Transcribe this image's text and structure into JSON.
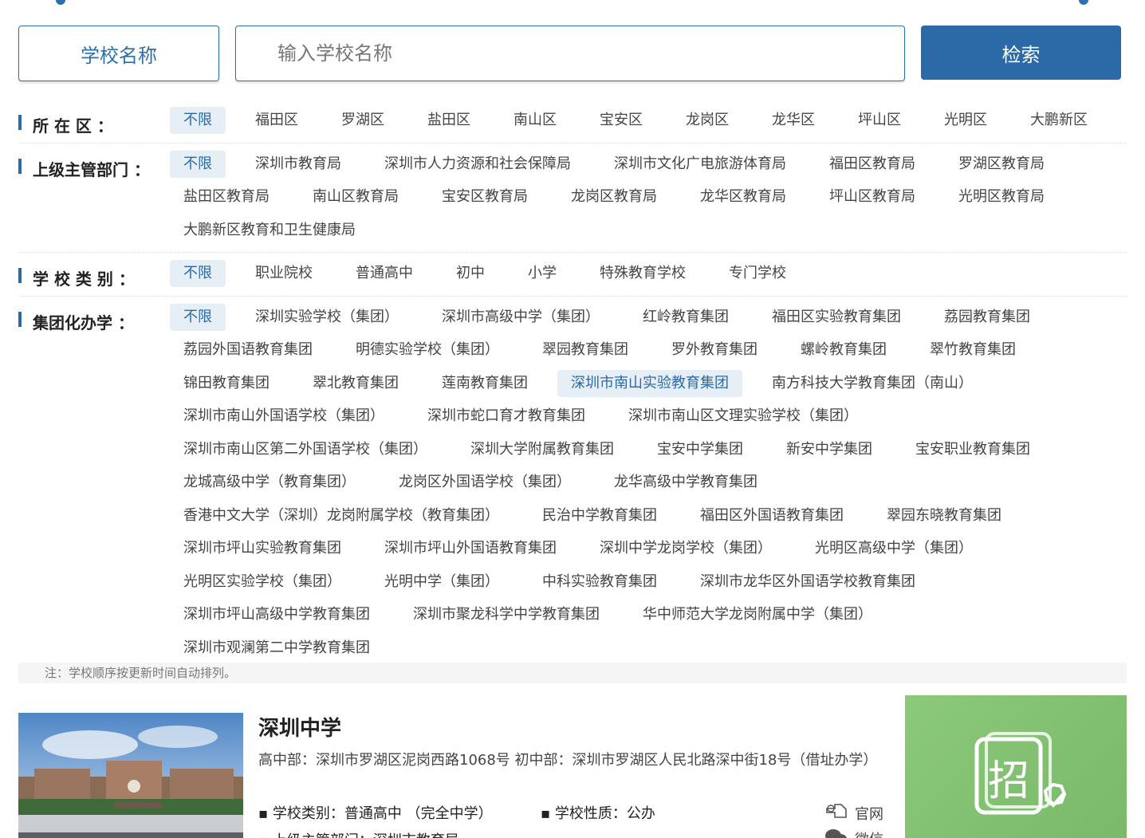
{
  "search": {
    "type_label": "学校名称",
    "placeholder": "输入学校名称",
    "button_label": "检索"
  },
  "filters": {
    "district": {
      "label": "所 在 区 ：",
      "options": [
        "不限",
        "福田区",
        "罗湖区",
        "盐田区",
        "南山区",
        "宝安区",
        "龙岗区",
        "龙华区",
        "坪山区",
        "光明区",
        "大鹏新区"
      ],
      "selected": "不限"
    },
    "department": {
      "label": "上级主管部门 ：",
      "options": [
        "不限",
        "深圳市教育局",
        "深圳市人力资源和社会保障局",
        "深圳市文化广电旅游体育局",
        "福田区教育局",
        "罗湖区教育局",
        "盐田区教育局",
        "南山区教育局",
        "宝安区教育局",
        "龙岗区教育局",
        "龙华区教育局",
        "坪山区教育局",
        "光明区教育局",
        "大鹏新区教育和卫生健康局"
      ],
      "selected": "不限"
    },
    "category": {
      "label": "学 校 类 别 ：",
      "options": [
        "不限",
        "职业院校",
        "普通高中",
        "初中",
        "小学",
        "特殊教育学校",
        "专门学校"
      ],
      "selected": "不限"
    },
    "group": {
      "label": "集团化办学 ：",
      "options": [
        "不限",
        "深圳实验学校（集团）",
        "深圳市高级中学（集团）",
        "红岭教育集团",
        "福田区实验教育集团",
        "荔园教育集团",
        "荔园外国语教育集团",
        "明德实验学校（集团）",
        "翠园教育集团",
        "罗外教育集团",
        "螺岭教育集团",
        "翠竹教育集团",
        "锦田教育集团",
        "翠北教育集团",
        "莲南教育集团",
        "深圳市南山实验教育集团",
        "南方科技大学教育集团（南山）",
        "深圳市南山外国语学校（集团）",
        "深圳市蛇口育才教育集团",
        "深圳市南山区文理实验学校（集团）",
        "深圳市南山区第二外国语学校（集团）",
        "深圳大学附属教育集团",
        "宝安中学集团",
        "新安中学集团",
        "宝安职业教育集团",
        "龙城高级中学（教育集团）",
        "龙岗区外国语学校（集团）",
        "龙华高级中学教育集团",
        "香港中文大学（深圳）龙岗附属学校（教育集团）",
        "民治中学教育集团",
        "福田区外国语教育集团",
        "翠园东晓教育集团",
        "深圳市坪山实验教育集团",
        "深圳市坪山外国语教育集团",
        "深圳中学龙岗学校（集团）",
        "光明区高级中学（集团）",
        "光明区实验学校（集团）",
        "光明中学（集团）",
        "中科实验教育集团",
        "深圳市龙华区外国语学校教育集团",
        "深圳市坪山高级中学教育集团",
        "深圳市聚龙科学中学教育集团",
        "华中师范大学龙岗附属中学（集团）",
        "深圳市观澜第二中学教育集团"
      ],
      "selected": "不限",
      "highlighted": "深圳市南山实验教育集团"
    }
  },
  "note": "注：学校顺序按更新时间自动排列。",
  "school": {
    "name": "深圳中学",
    "address": "高中部：深圳市罗湖区泥岗西路1068号 初中部：深圳市罗湖区人民北路深中街18号（借址办学）",
    "category": "▪ 学校类别：普通高中 （完全中学）",
    "nature": "▪ 学校性质：公办",
    "department": "▪ 上级主管部门：深圳市教育局",
    "website_label": "官网",
    "wechat_label": "微信",
    "badge_char": "招"
  },
  "colors": {
    "primary": "#2b6aa6",
    "active_bg": "#e6eef6",
    "recruit_bg": "#7ab86a"
  }
}
